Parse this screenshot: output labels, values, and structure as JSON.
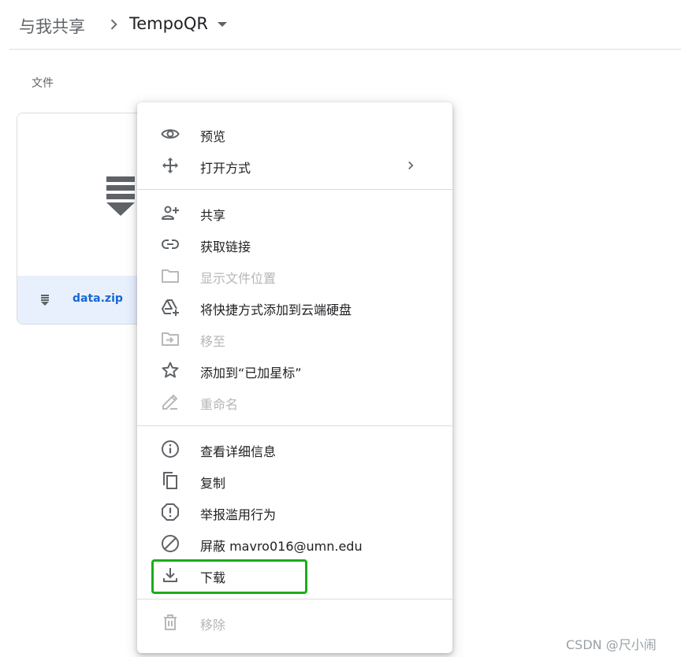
{
  "breadcrumb": {
    "root": "与我共享",
    "current": "TempoQR"
  },
  "section_label": "文件",
  "file": {
    "name": "data.zip",
    "icon": "zip-file-icon"
  },
  "context_menu": {
    "items": [
      {
        "label": "预览",
        "icon": "eye-icon",
        "enabled": true
      },
      {
        "label": "打开方式",
        "icon": "move-arrows-icon",
        "enabled": true,
        "submenu": true
      },
      {
        "label": "共享",
        "icon": "add-person-icon",
        "enabled": true
      },
      {
        "label": "获取链接",
        "icon": "link-icon",
        "enabled": true
      },
      {
        "label": "显示文件位置",
        "icon": "folder-icon",
        "enabled": false
      },
      {
        "label": "将快捷方式添加到云端硬盘",
        "icon": "add-shortcut-drive-icon",
        "enabled": true
      },
      {
        "label": "移至",
        "icon": "move-to-folder-icon",
        "enabled": false
      },
      {
        "label": "添加到“已加星标”",
        "icon": "star-icon",
        "enabled": true
      },
      {
        "label": "重命名",
        "icon": "pencil-icon",
        "enabled": false
      },
      {
        "label": "查看详细信息",
        "icon": "info-icon",
        "enabled": true
      },
      {
        "label": "复制",
        "icon": "copy-icon",
        "enabled": true
      },
      {
        "label": "举报滥用行为",
        "icon": "report-icon",
        "enabled": true
      },
      {
        "label": "屏蔽 mavro016@umn.edu",
        "icon": "block-icon",
        "enabled": true
      },
      {
        "label": "下载",
        "icon": "download-icon",
        "enabled": true,
        "highlighted": true
      },
      {
        "label": "移除",
        "icon": "trash-icon",
        "enabled": false
      }
    ]
  },
  "watermark": "CSDN @尺小闹",
  "colors": {
    "highlight_border": "#1aad19",
    "file_bar": "#e8f0fe",
    "file_name": "#1967d2",
    "disabled_text": "#b4b6b9"
  }
}
